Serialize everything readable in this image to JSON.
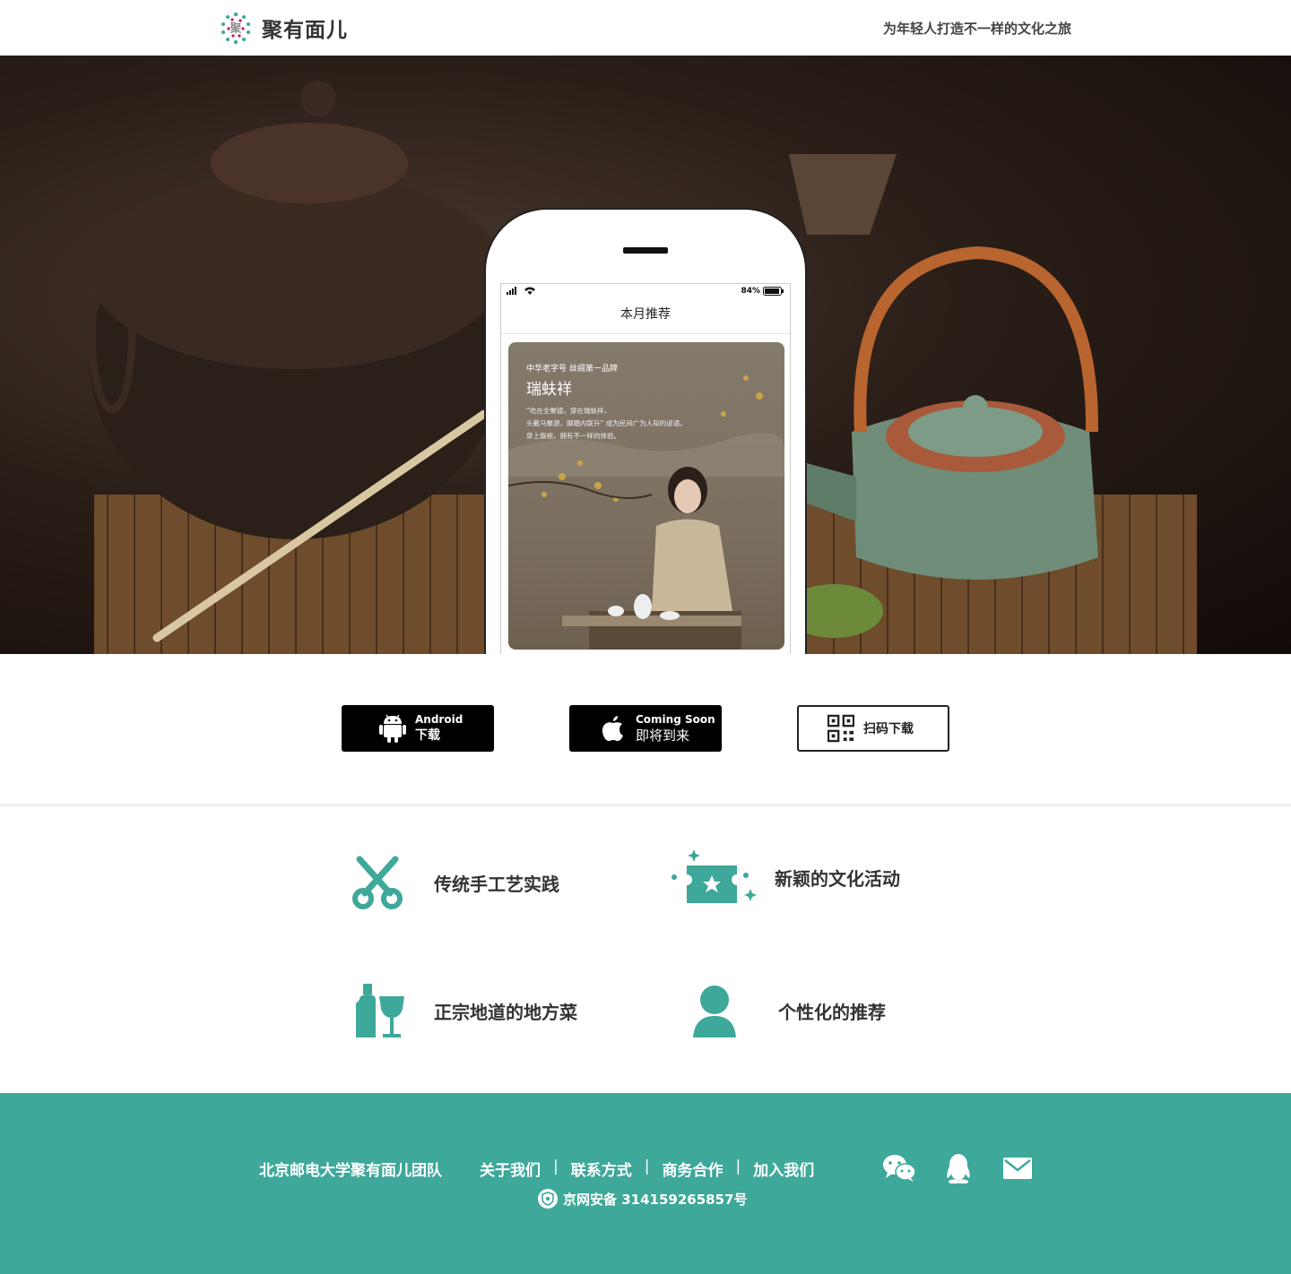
{
  "header": {
    "brand": "聚有面儿",
    "slogan": "为年轻人打造不一样的文化之旅"
  },
  "phone": {
    "status_battery": "84%",
    "screen_title": "本月推荐",
    "card1": {
      "subtitle": "中华老字号 丝绸第一品牌",
      "title": "瑞蚨祥",
      "desc": "“吃在全聚德，穿在瑞蚨祥，\n头戴马聚源，脚踏内联升” 成为民间广为人知的谚语。\n穿上旗袍，拥有不一样的体验。"
    }
  },
  "downloads": {
    "android": {
      "line1": "Android",
      "line2": "下载",
      "icon": "android-icon"
    },
    "ios": {
      "line1": "Coming Soon",
      "line2": "即将到来",
      "icon": "apple-icon"
    },
    "qr": {
      "label": "扫码下载",
      "icon": "qr-code-icon"
    }
  },
  "features": [
    {
      "label": "传统手工艺实践",
      "icon": "scissors-icon"
    },
    {
      "label": "新颖的文化活动",
      "icon": "ticket-star-icon"
    },
    {
      "label": "正宗地道的地方菜",
      "icon": "bottle-glass-icon"
    },
    {
      "label": "个性化的推荐",
      "icon": "user-icon"
    }
  ],
  "footer": {
    "team": "北京邮电大学聚有面儿团队",
    "links": [
      "关于我们",
      "联系方式",
      "商务合作",
      "加入我们"
    ],
    "separator": "|",
    "icp": "京网安备 314159265857号",
    "social": [
      "wechat-icon",
      "qq-icon",
      "mail-icon"
    ]
  },
  "colors": {
    "accent": "#3ea89a",
    "footer_bg": "#3ea89a",
    "text": "#333333"
  }
}
